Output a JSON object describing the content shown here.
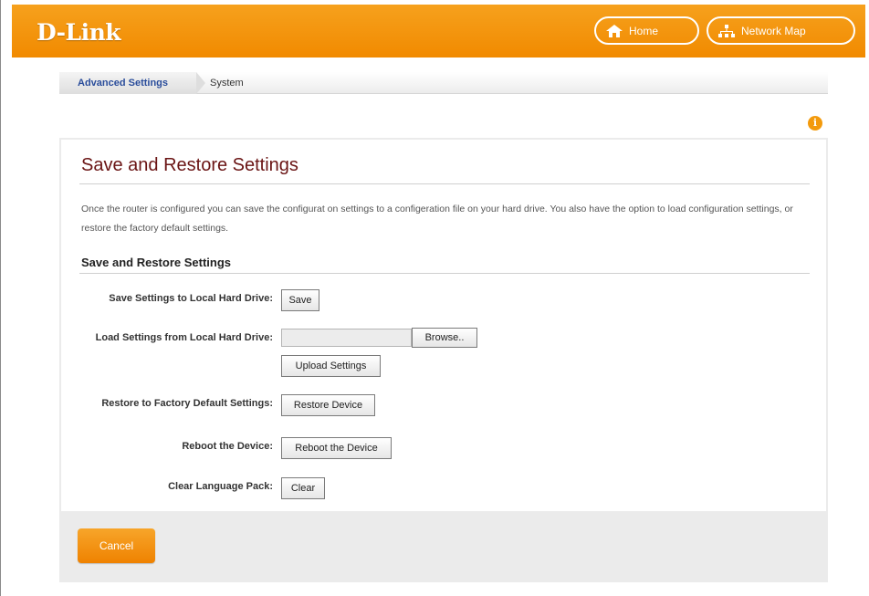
{
  "header": {
    "logo": "D-Link",
    "home_label": "Home",
    "network_map_label": "Network Map"
  },
  "breadcrumb": {
    "section": "Advanced Settings",
    "page": "System"
  },
  "panel": {
    "title": "Save and Restore Settings",
    "description": "Once the router is configured you can save the configurat on settings to a configeration file on your hard drive. You also have the option to load configuration settings, or restore the factory default settings.",
    "section_title": "Save and Restore Settings",
    "rows": {
      "save_label": "Save Settings to Local Hard Drive:",
      "save_button": "Save",
      "load_label": "Load Settings from Local Hard Drive:",
      "browse_button": "Browse..",
      "upload_button": "Upload Settings",
      "restore_label": "Restore to Factory Default Settings:",
      "restore_button": "Restore Device",
      "reboot_label": "Reboot the Device:",
      "reboot_button": "Reboot the Device",
      "clear_label": "Clear Language Pack:",
      "clear_button": "Clear"
    },
    "cancel_button": "Cancel"
  },
  "colors": {
    "brand_orange": "#f18a00",
    "title_maroon": "#6a1414",
    "crumb_blue": "#2a4d9b"
  }
}
